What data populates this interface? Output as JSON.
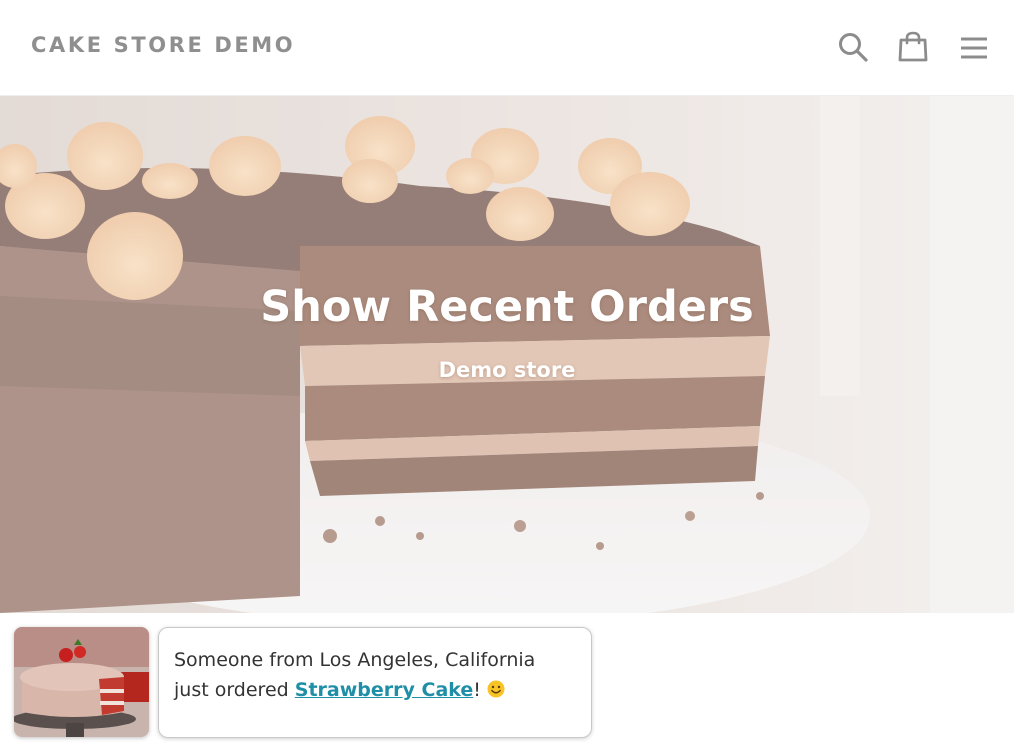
{
  "header": {
    "store_title": "CAKE STORE DEMO",
    "icons": [
      "search-icon",
      "shopping-bag-icon",
      "menu-icon"
    ]
  },
  "hero": {
    "title": "Show Recent Orders",
    "subtitle": "Demo store"
  },
  "notification": {
    "line1": "Someone from Los Angeles, California",
    "line2_prefix": "just ordered",
    "product": "Strawberry Cake",
    "suffix": "!",
    "emoji": "smiley-emoji-icon"
  },
  "colors": {
    "title_gray": "#8f8f8f",
    "icon_gray": "#8c8c8c",
    "link_teal": "#1f8fa8",
    "text_dark": "#333333"
  }
}
